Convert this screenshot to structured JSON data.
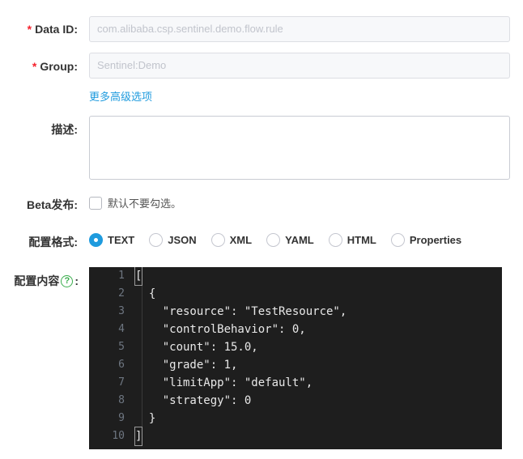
{
  "form": {
    "data_id": {
      "required_mark": "*",
      "label": "Data ID:",
      "value": "com.alibaba.csp.sentinel.demo.flow.rule"
    },
    "group": {
      "required_mark": "*",
      "label": "Group:",
      "value": "Sentinel:Demo"
    },
    "advanced_link": "更多高级选项",
    "description": {
      "label": "描述:",
      "value": ""
    },
    "beta": {
      "label": "Beta发布:",
      "checkbox_label": "默认不要勾选。",
      "checked": false
    },
    "format": {
      "label": "配置格式:",
      "selected": "TEXT",
      "options": [
        "TEXT",
        "JSON",
        "XML",
        "YAML",
        "HTML",
        "Properties"
      ]
    },
    "content": {
      "label_text": "配置内容",
      "help_icon": "?",
      "colon": ":"
    }
  },
  "editor": {
    "lines": [
      {
        "num": "1",
        "text": "["
      },
      {
        "num": "2",
        "text": "  {"
      },
      {
        "num": "3",
        "text": "    \"resource\": \"TestResource\","
      },
      {
        "num": "4",
        "text": "    \"controlBehavior\": 0,"
      },
      {
        "num": "5",
        "text": "    \"count\": 15.0,"
      },
      {
        "num": "6",
        "text": "    \"grade\": 1,"
      },
      {
        "num": "7",
        "text": "    \"limitApp\": \"default\","
      },
      {
        "num": "8",
        "text": "    \"strategy\": 0"
      },
      {
        "num": "9",
        "text": "  }"
      },
      {
        "num": "10",
        "text": "]"
      }
    ]
  },
  "colors": {
    "accent": "#1f9bde",
    "required": "#f5222d",
    "help": "#3aad4d",
    "editor_bg": "#1e1e1e"
  }
}
